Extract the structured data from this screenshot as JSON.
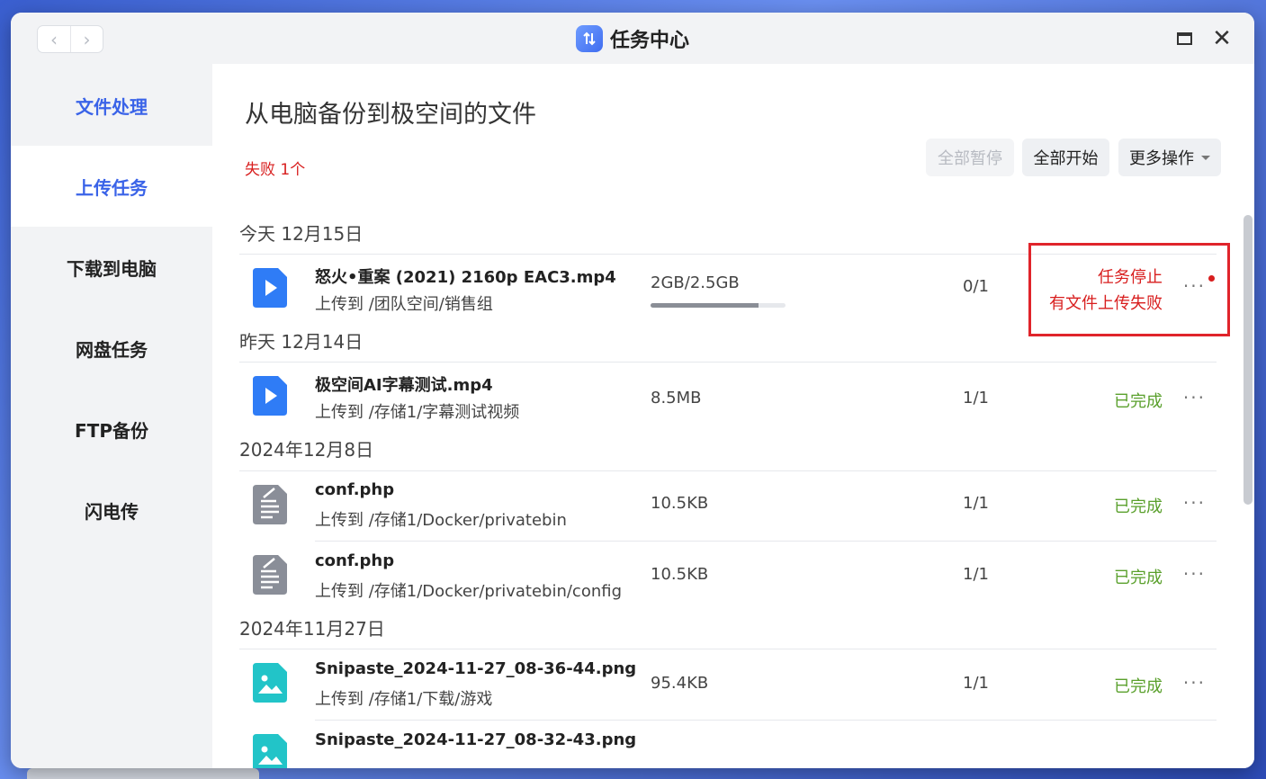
{
  "window": {
    "app_title": "任务中心",
    "icons": {
      "back": "chevron-left-icon",
      "forward": "chevron-right-icon",
      "maximize": "maximize-icon",
      "close": "close-icon"
    }
  },
  "sidebar": {
    "items": [
      {
        "label": "文件处理",
        "state": "section"
      },
      {
        "label": "上传任务",
        "state": "active"
      },
      {
        "label": "下载到电脑",
        "state": "normal"
      },
      {
        "label": "网盘任务",
        "state": "normal"
      },
      {
        "label": "FTP备份",
        "state": "normal"
      },
      {
        "label": "闪电传",
        "state": "normal"
      }
    ]
  },
  "main": {
    "heading": "从电脑备份到极空间的文件",
    "fail_summary": "失败 1个",
    "toolbar": {
      "pause_all": "全部暂停",
      "start_all": "全部开始",
      "more_actions": "更多操作"
    },
    "groups": [
      {
        "label": "今天 12月15日",
        "rows": [
          {
            "icon": "video-file-icon",
            "name": "怒火•重案 (2021) 2160p EAC3.mp4",
            "dest": "上传到 /团队空间/销售组",
            "size": "2GB/2.5GB",
            "progress": 0.8,
            "count": "0/1",
            "status_line1": "任务停止",
            "status_line2": "有文件上传失败",
            "status_type": "error"
          }
        ]
      },
      {
        "label": "昨天 12月14日",
        "rows": [
          {
            "icon": "video-file-icon",
            "name": "极空间AI字幕测试.mp4",
            "dest": "上传到 /存储1/字幕测试视频",
            "size": "8.5MB",
            "count": "1/1",
            "status": "已完成",
            "status_type": "done"
          }
        ]
      },
      {
        "label": "2024年12月8日",
        "rows": [
          {
            "icon": "document-file-icon",
            "name": "conf.php",
            "dest": "上传到 /存储1/Docker/privatebin",
            "size": "10.5KB",
            "count": "1/1",
            "status": "已完成",
            "status_type": "done"
          },
          {
            "icon": "document-file-icon",
            "name": "conf.php",
            "dest": "上传到 /存储1/Docker/privatebin/config",
            "size": "10.5KB",
            "count": "1/1",
            "status": "已完成",
            "status_type": "done"
          }
        ]
      },
      {
        "label": "2024年11月27日",
        "rows": [
          {
            "icon": "image-file-icon",
            "name": "Snipaste_2024-11-27_08-36-44.png",
            "dest": "上传到 /存储1/下载/游戏",
            "size": "95.4KB",
            "count": "1/1",
            "status": "已完成",
            "status_type": "done"
          },
          {
            "icon": "image-file-icon",
            "name": "Snipaste_2024-11-27_08-32-43.png"
          }
        ]
      }
    ],
    "more_glyph": "···"
  },
  "colors": {
    "accent": "#3a63e8",
    "error": "#d81e1e",
    "success": "#5aa02c"
  }
}
